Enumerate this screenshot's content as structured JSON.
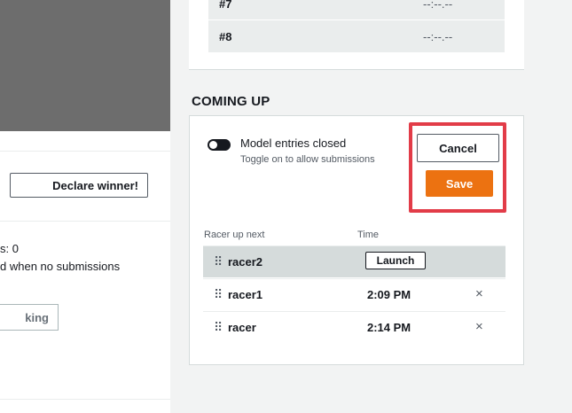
{
  "leaderboard": {
    "ranks": [
      {
        "position": "#7",
        "time": "--:--.--"
      },
      {
        "position": "#8",
        "time": "--:--.--"
      }
    ]
  },
  "left_panel": {
    "declare_winner_label": "Declare winner!",
    "submissions_text": "s: 0",
    "no_submissions_text": "d when no submissions",
    "secondary_button_label": "king"
  },
  "coming_up": {
    "title": "COMING UP",
    "toggle_label": "Model entries closed",
    "toggle_description": "Toggle on to allow submissions",
    "toggle_on": false,
    "cancel_label": "Cancel",
    "save_label": "Save",
    "columns": {
      "racer": "Racer up next",
      "time": "Time"
    },
    "racers": [
      {
        "name": "racer2",
        "time": "",
        "action": "Launch"
      },
      {
        "name": "racer1",
        "time": "2:09 PM",
        "action": "×"
      },
      {
        "name": "racer",
        "time": "2:14 PM",
        "action": "×"
      }
    ]
  },
  "colors": {
    "save": "#ec7211",
    "highlight": "#e23c48",
    "page_bg": "#f2f3f3"
  }
}
